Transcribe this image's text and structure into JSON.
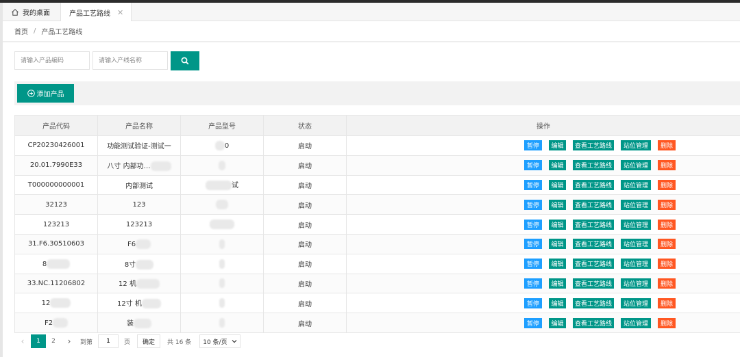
{
  "tabs": {
    "home_label": "我的桌面",
    "active_label": "产品工艺路线",
    "close_glyph": "✕"
  },
  "breadcrumb": {
    "home": "首页",
    "separator": "/",
    "current": "产品工艺路线"
  },
  "search": {
    "code_placeholder": "请输入产品编码",
    "line_placeholder": "请输入产线名称"
  },
  "toolbar": {
    "add_label": "添加产品"
  },
  "table": {
    "columns": [
      "产品代码",
      "产品名称",
      "产品型号",
      "状态",
      "操作"
    ],
    "rows": [
      {
        "code": "CP20230426001",
        "name": "功能测试验证-测试一",
        "model": "0",
        "status": "启动"
      },
      {
        "code": "20.01.7990E33",
        "name": "八寸 内部功…",
        "model": "",
        "status": "启动"
      },
      {
        "code": "T000000000001",
        "name": "内部测试",
        "model": "试",
        "status": "启动"
      },
      {
        "code": "32123",
        "name": "123",
        "model": "",
        "status": "启动"
      },
      {
        "code": "123213",
        "name": "123213",
        "model": "",
        "status": "启动"
      },
      {
        "code": "31.F6.30510603",
        "name": "F6",
        "model": "",
        "status": "启动"
      },
      {
        "code": "8",
        "name": "8寸",
        "model": "",
        "status": "启动"
      },
      {
        "code": "33.NC.11206802",
        "name": "12 机",
        "model": "",
        "status": "启动"
      },
      {
        "code": "12",
        "name": "12寸 机",
        "model": "",
        "status": "启动"
      },
      {
        "code": "F2",
        "name": "装",
        "model": "",
        "status": "启动"
      }
    ],
    "actions": {
      "pause": "暂停",
      "edit": "编辑",
      "route": "查看工艺路线",
      "station": "站位管理",
      "delete": "删除"
    }
  },
  "pager": {
    "pages": [
      "1",
      "2"
    ],
    "goto_label": "到第",
    "goto_value": "1",
    "page_unit": "页",
    "confirm": "确定",
    "total": "共 16 条",
    "page_size": "10 条/页"
  },
  "colors": {
    "primary": "#009688",
    "pause": "#1e9fff",
    "danger": "#ff5722"
  }
}
